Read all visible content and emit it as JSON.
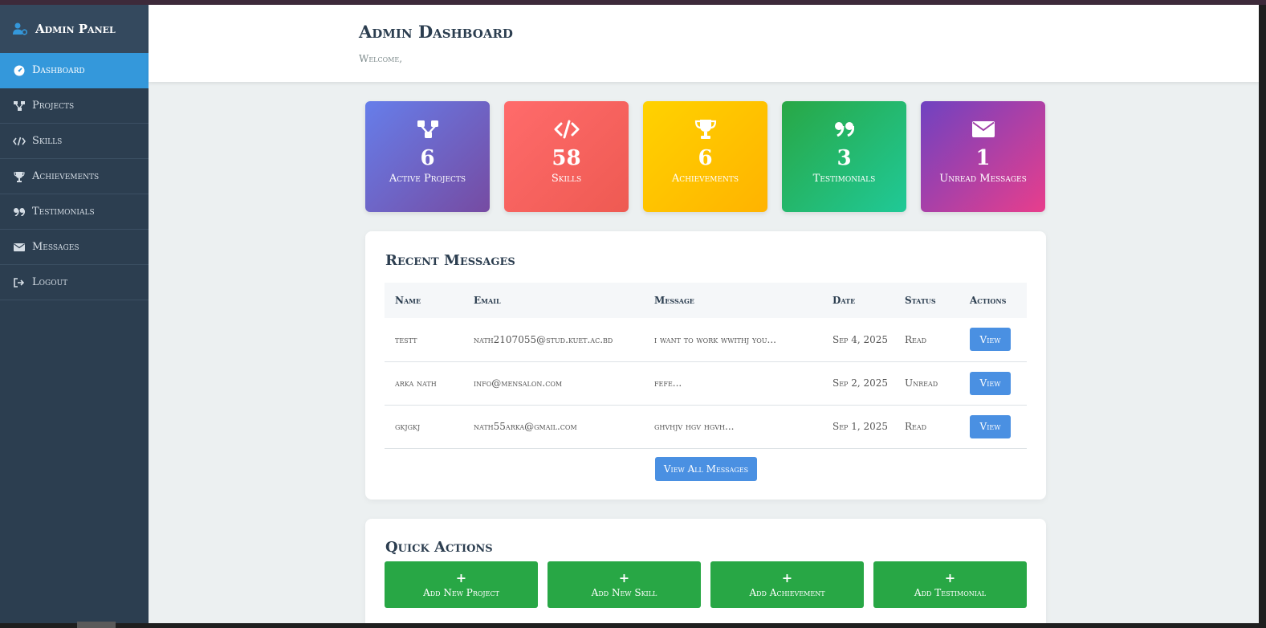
{
  "sidebar": {
    "brand": "Admin Panel",
    "items": [
      {
        "label": "Dashboard",
        "icon": "dashboard-icon"
      },
      {
        "label": "Projects",
        "icon": "project-diagram-icon"
      },
      {
        "label": "Skills",
        "icon": "code-icon"
      },
      {
        "label": "Achievements",
        "icon": "trophy-icon"
      },
      {
        "label": "Testimonials",
        "icon": "quote-icon"
      },
      {
        "label": "Messages",
        "icon": "envelope-icon"
      },
      {
        "label": "Logout",
        "icon": "logout-icon"
      }
    ]
  },
  "header": {
    "title": "Admin Dashboard",
    "welcome": "Welcome,"
  },
  "stats": [
    {
      "value": "6",
      "label": "Active Projects",
      "icon": "project-diagram-icon",
      "gradient": [
        "#667eea",
        "#764ba2"
      ]
    },
    {
      "value": "58",
      "label": "Skills",
      "icon": "code-icon",
      "gradient": [
        "#ff6b6b",
        "#ee5a52"
      ]
    },
    {
      "value": "6",
      "label": "Achievements",
      "icon": "trophy-icon",
      "gradient": [
        "#ffd200",
        "#ffb300"
      ]
    },
    {
      "value": "3",
      "label": "Testimonials",
      "icon": "quote-icon",
      "gradient": [
        "#28a745",
        "#20c997"
      ]
    },
    {
      "value": "1",
      "label": "Unread Messages",
      "icon": "envelope-icon",
      "gradient": [
        "#6f42c1",
        "#e83e8c"
      ]
    }
  ],
  "messages": {
    "title": "Recent Messages",
    "columns": [
      "Name",
      "Email",
      "Message",
      "Date",
      "Status",
      "Actions"
    ],
    "rows": [
      {
        "name": "testt",
        "email": "nath2107055@stud.kuet.ac.bd",
        "message": "i want to work wwithj you...",
        "date": "Sep 4, 2025",
        "status": "Read",
        "action": "View"
      },
      {
        "name": "arka nath",
        "email": "info@mensalon.com",
        "message": "fefe...",
        "date": "Sep 2, 2025",
        "status": "Unread",
        "action": "View"
      },
      {
        "name": "gkjgkj",
        "email": "nath55arka@gmail.com",
        "message": "ghvhjv hgv hgvh...",
        "date": "Sep 1, 2025",
        "status": "Read",
        "action": "View"
      }
    ],
    "view_all": "View All Messages"
  },
  "quick_actions": {
    "title": "Quick Actions",
    "plus": "+",
    "items": [
      "Add New Project",
      "Add New Skill",
      "Add Achievement",
      "Add Testimonial"
    ]
  },
  "colors": {
    "sidebar": "#2c3e50",
    "accent": "#3498db",
    "button": "#4a90e2",
    "success": "#28a745"
  }
}
